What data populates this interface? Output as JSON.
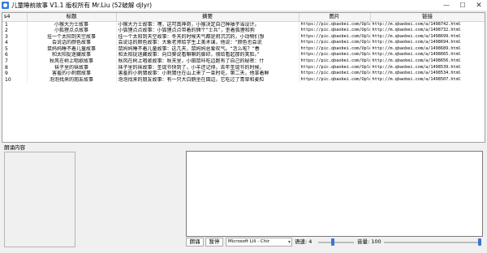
{
  "window": {
    "title": "儿童睡前故事 V1.1   版权所有 Mr.Liu (52破解 djlyr)",
    "buttons": {
      "minimize": "—",
      "maximize": "☐",
      "close": "✕"
    }
  },
  "table": {
    "headers": {
      "index": "s4",
      "title": "标题",
      "summary": "摘要",
      "image": "图片",
      "link": "链接"
    },
    "rows": [
      {
        "index": "1",
        "title": "小猴大力士故事",
        "summary": "小猴大力士故事：嘿，这可真神奇，小猴决定自己种袖子当设计。",
        "image": "https://pic.qbaobei.com/Uploads/",
        "link": "http://m.qbaobei.com/a/1498742.html"
      },
      {
        "index": "2",
        "title": "小狐狸点点故事",
        "summary": "小狐狸点点故事：小狐狸点点带着的狮个“士兵”，歪着狐狸和狗",
        "image": "https://pic.qbaobei.com/Uploads/",
        "link": "http://m.qbaobei.com/a/1498732.html"
      },
      {
        "index": "3",
        "title": "挂一个太阳到天空故事",
        "summary": "挂一个太阳到天空故事：冬天的时候天气都是阴沉沉的，小动物们想",
        "image": "https://pic.qbaobei.com/Uploads/",
        "link": "http://m.qbaobei.com/a/1498699.html"
      },
      {
        "index": "4",
        "title": "会说话的颜色故事",
        "summary": "会说话的颜色故事：大象老师给学生上美术课，他说：“颜色也会说",
        "image": "https://pic.qbaobei.com/Uploads/",
        "link": "http://m.qbaobei.com/a/1498694.html"
      },
      {
        "index": "5",
        "title": "鼠妈妈睡不着儿童故事",
        "summary": "鼠妈妈睡不着儿童故事：这几天，鼠妈妈总爱叹气。“怎么啦？”春",
        "image": "https://pic.qbaobei.com/Uploads/",
        "link": "http://m.qbaobei.com/a/1498689.html"
      },
      {
        "index": "6",
        "title": "和太阳捉迷藏故事",
        "summary": "和太阳捉迷藏故事：向日葵说看嘛嘛的脚印，很给看起那的笑脸。”",
        "image": "https://pic.qbaobei.com/Uploads/",
        "link": "http://m.qbaobei.com/a/1498665.html"
      },
      {
        "index": "7",
        "title": "秋风在树上唱歌故事",
        "summary": "秋风在树上唱歌故事：秋天里，小田鼠咔吃边跑有了自己的秘密：什",
        "image": "https://pic.qbaobei.com/Uploads/",
        "link": "http://m.qbaobei.com/a/1498656.html"
      },
      {
        "index": "8",
        "title": "袜子里的袜故事",
        "summary": "袜子里的袜故事：圣诞节快到了，小羊还记得，去年圣诞节的时候，",
        "image": "https://pic.qbaobei.com/Uploads/",
        "link": "http://m.qbaobei.com/a/1498539.html"
      },
      {
        "index": "9",
        "title": "害羞的小刺猬故事",
        "summary": "害羞的小刺猬故事：小刺猬住在山上来了一束时花，第二天，他拿着鲜",
        "image": "https://pic.qbaobei.com/Uploads/",
        "link": "http://m.qbaobei.com/a/1498534.html"
      },
      {
        "index": "10",
        "title": "泡泡找来的朋友故事",
        "summary": "泡泡找来的朋友故事：有一只大白鹅坐在田边，它吃过了青草和麦粒",
        "image": "https://pic.qbaobei.com/Uploads/",
        "link": "http://m.qbaobei.com/a/1498507.html"
      }
    ]
  },
  "reader": {
    "label": "朗诵内容",
    "content": "",
    "read_button": "朗诵",
    "pause_button": "暂停",
    "voice_selected": "Microsoft Lili - Chir",
    "speed_label": "语速: 4",
    "volume_label": "音量: 100",
    "speed_level": 0.4,
    "volume_level": 1.0,
    "accent_color": "#3a76d0"
  }
}
